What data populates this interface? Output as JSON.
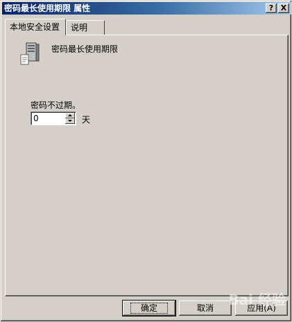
{
  "window": {
    "title": "密码最长使用期限 属性",
    "help_button": "?",
    "close_button": "X"
  },
  "tabs": [
    {
      "label": "本地安全设置",
      "active": true
    },
    {
      "label": "说明",
      "active": false
    }
  ],
  "policy": {
    "name": "密码最长使用期限",
    "icon": "server-policy-icon"
  },
  "setting": {
    "label": "密码不过期。",
    "value": "0",
    "unit": "天"
  },
  "buttons": {
    "ok": "确定",
    "cancel": "取消",
    "apply": "应用(A)"
  },
  "watermark": {
    "text": "Bai 经验"
  }
}
